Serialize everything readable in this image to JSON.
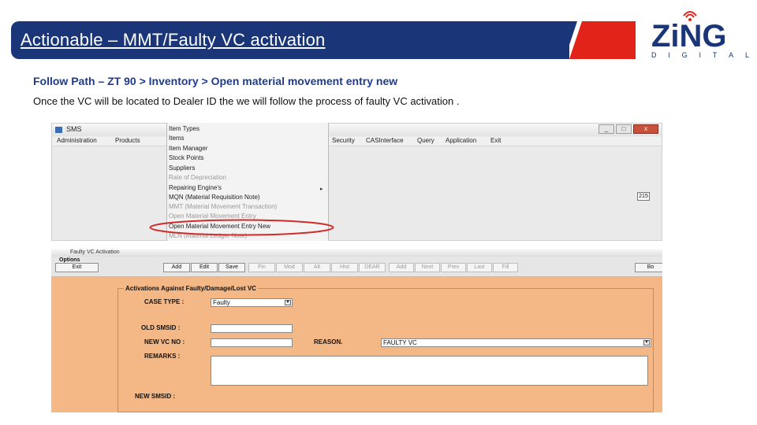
{
  "header": {
    "title": "Actionable – MMT/Faulty VC activation",
    "colors": {
      "banner": "#1a3679",
      "stripe": "#e2231a"
    }
  },
  "logo": {
    "name": "ZiNG",
    "sub_letters": [
      "D",
      "I",
      "G",
      "I",
      "T",
      "A",
      "L"
    ]
  },
  "path_text": "Follow Path – ZT 90 > Inventory > Open material movement entry new",
  "description": "Once the VC will be located to Dealer ID the we will follow the process of faulty VC activation .",
  "sms_window": {
    "title": "SMS",
    "window_buttons": [
      "_",
      "□",
      "x"
    ],
    "menu_left": [
      "Administration",
      "Products"
    ],
    "menu_right": [
      "Security",
      "CASInterface",
      "Query",
      "Application",
      "Exit"
    ],
    "field_value": "215",
    "dropdown_items": [
      {
        "label": "Item Types",
        "enabled": true
      },
      {
        "label": "Items",
        "enabled": true
      },
      {
        "label": "Item Manager",
        "enabled": true
      },
      {
        "label": "Stock Points",
        "enabled": true
      },
      {
        "label": "Suppliers",
        "enabled": true
      },
      {
        "label": "Rate of Depreciation",
        "enabled": false
      },
      {
        "label": "Repairing Engine's",
        "enabled": true
      },
      {
        "label": "MQN (Material Requisition Note)",
        "enabled": true
      },
      {
        "label": "MMT (Material Movement Transaction)",
        "enabled": false
      },
      {
        "label": "Open Material Movement Entry",
        "enabled": false
      },
      {
        "label": "Open Material Movement Entry New",
        "enabled": true,
        "highlighted": true
      },
      {
        "label": "MLN (Material Ledger Note)",
        "enabled": false
      }
    ],
    "submenu_arrow": "▸"
  },
  "faulty_window": {
    "title": "Faulty VC Activation",
    "options_label": "Options",
    "buttons": [
      {
        "label": "Exit",
        "enabled": true
      },
      {
        "label": "Add",
        "enabled": true
      },
      {
        "label": "Edit",
        "enabled": true
      },
      {
        "label": "Save",
        "enabled": true
      },
      {
        "label": "Fin",
        "enabled": false
      },
      {
        "label": "Mod",
        "enabled": false
      },
      {
        "label": "Alt",
        "enabled": false
      },
      {
        "label": "Hist",
        "enabled": false
      },
      {
        "label": "DEAR",
        "enabled": false
      },
      {
        "label": "Add",
        "enabled": false
      },
      {
        "label": "Next",
        "enabled": false
      },
      {
        "label": "Prev",
        "enabled": false
      },
      {
        "label": "Last",
        "enabled": false
      },
      {
        "label": "Fill",
        "enabled": false
      },
      {
        "label": "Bo",
        "enabled": true
      }
    ],
    "form_title": "Activations Against Faulty/Damage/Lost VC",
    "case_type_label": "CASE TYPE :",
    "case_type_value": "Faulty",
    "old_smsid_label": "OLD SMSID :",
    "new_vc_no_label": "NEW VC NO :",
    "reason_label": "REASON.",
    "reason_value": "FAULTY VC",
    "remarks_label": "REMARKS :",
    "new_smsid_label": "NEW SMSID :",
    "bg_color": "#f3b885"
  }
}
